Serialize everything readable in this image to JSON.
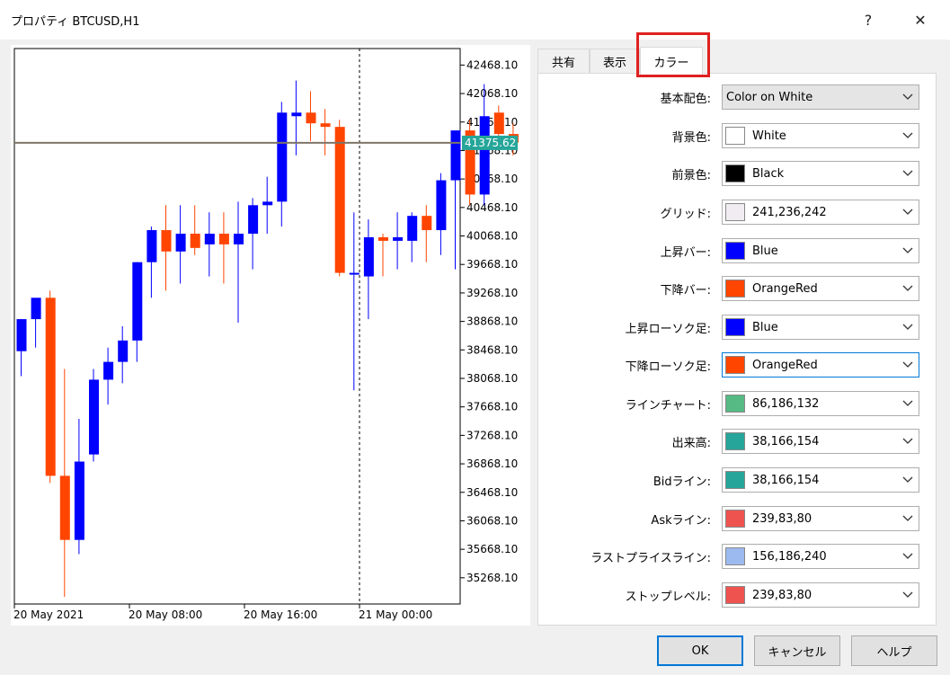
{
  "window": {
    "title": "プロパティ BTCUSD,H1",
    "help_glyph": "?",
    "close_glyph": "✕"
  },
  "tabs": [
    {
      "label": "共有",
      "active": false
    },
    {
      "label": "表示",
      "active": false
    },
    {
      "label": "カラー",
      "active": true
    }
  ],
  "color_rows": [
    {
      "label": "基本配色:",
      "value": "Color on White",
      "swatch": null
    },
    {
      "label": "背景色:",
      "value": "White",
      "swatch": "#ffffff"
    },
    {
      "label": "前景色:",
      "value": "Black",
      "swatch": "#000000"
    },
    {
      "label": "グリッド:",
      "value": "241,236,242",
      "swatch": "#f1ecf2"
    },
    {
      "label": "上昇バー:",
      "value": "Blue",
      "swatch": "#0000ff"
    },
    {
      "label": "下降バー:",
      "value": "OrangeRed",
      "swatch": "#ff4500"
    },
    {
      "label": "上昇ローソク足:",
      "value": "Blue",
      "swatch": "#0000ff"
    },
    {
      "label": "下降ローソク足:",
      "value": "OrangeRed",
      "swatch": "#ff4500"
    },
    {
      "label": "ラインチャート:",
      "value": "86,186,132",
      "swatch": "#56ba84"
    },
    {
      "label": "出来高:",
      "value": "38,166,154",
      "swatch": "#26a69a"
    },
    {
      "label": "Bidライン:",
      "value": "38,166,154",
      "swatch": "#26a69a"
    },
    {
      "label": "Askライン:",
      "value": "239,83,80",
      "swatch": "#ef5350"
    },
    {
      "label": "ラストプライスライン:",
      "value": "156,186,240",
      "swatch": "#9cbaf0"
    },
    {
      "label": "ストップレベル:",
      "value": "239,83,80",
      "swatch": "#ef5350"
    }
  ],
  "buttons": {
    "ok": "OK",
    "cancel": "キャンセル",
    "help": "ヘルプ"
  },
  "chart_data": {
    "type": "candlestick",
    "symbol": "BTCUSD,H1",
    "y_ticks": [
      "42468.10",
      "42068.10",
      "41668.10",
      "41268.10",
      "40868.10",
      "40468.10",
      "40068.10",
      "39668.10",
      "39268.10",
      "38868.10",
      "38468.10",
      "38068.10",
      "37668.10",
      "37268.10",
      "36868.10",
      "36468.10",
      "36068.10",
      "35668.10",
      "35268.10"
    ],
    "ylim": [
      34900,
      42700
    ],
    "x_ticks": [
      "20 May 2021",
      "20 May 08:00",
      "20 May 16:00",
      "21 May 00:00"
    ],
    "current_price_label": "41375.62",
    "current_price": 41375.62,
    "colors": {
      "up": "#0000ff",
      "down": "#ff4500",
      "price_tag": "#26a69a",
      "price_line": "#7f7467"
    },
    "candles": [
      {
        "o": 38450,
        "h": 38900,
        "l": 38100,
        "c": 38900
      },
      {
        "o": 38900,
        "h": 39000,
        "l": 38500,
        "c": 39200
      },
      {
        "o": 39200,
        "h": 39300,
        "l": 36600,
        "c": 36700
      },
      {
        "o": 36700,
        "h": 38200,
        "l": 35000,
        "c": 35800
      },
      {
        "o": 35800,
        "h": 37500,
        "l": 35600,
        "c": 36900
      },
      {
        "o": 37000,
        "h": 38200,
        "l": 36900,
        "c": 38050
      },
      {
        "o": 38050,
        "h": 38500,
        "l": 37700,
        "c": 38300
      },
      {
        "o": 38300,
        "h": 38800,
        "l": 38000,
        "c": 38600
      },
      {
        "o": 38600,
        "h": 39700,
        "l": 38300,
        "c": 39700
      },
      {
        "o": 39700,
        "h": 40200,
        "l": 39200,
        "c": 40150
      },
      {
        "o": 40150,
        "h": 40500,
        "l": 39300,
        "c": 39850
      },
      {
        "o": 39850,
        "h": 40500,
        "l": 39400,
        "c": 40100
      },
      {
        "o": 40100,
        "h": 40500,
        "l": 39800,
        "c": 39900
      },
      {
        "o": 39950,
        "h": 40400,
        "l": 39500,
        "c": 40100
      },
      {
        "o": 40100,
        "h": 40400,
        "l": 39400,
        "c": 39950
      },
      {
        "o": 39950,
        "h": 40550,
        "l": 38850,
        "c": 40100
      },
      {
        "o": 40100,
        "h": 40600,
        "l": 39600,
        "c": 40500
      },
      {
        "o": 40500,
        "h": 40900,
        "l": 40100,
        "c": 40550
      },
      {
        "o": 40550,
        "h": 41950,
        "l": 40200,
        "c": 41800
      },
      {
        "o": 41750,
        "h": 42250,
        "l": 41200,
        "c": 41800
      },
      {
        "o": 41800,
        "h": 42100,
        "l": 41400,
        "c": 41650
      },
      {
        "o": 41650,
        "h": 41850,
        "l": 41200,
        "c": 41600
      },
      {
        "o": 41600,
        "h": 41700,
        "l": 39500,
        "c": 39550
      },
      {
        "o": 39550,
        "h": 40400,
        "l": 37900,
        "c": 39550
      },
      {
        "o": 39500,
        "h": 40300,
        "l": 38900,
        "c": 40050
      },
      {
        "o": 40050,
        "h": 40100,
        "l": 39500,
        "c": 40000
      },
      {
        "o": 40000,
        "h": 40400,
        "l": 39600,
        "c": 40050
      },
      {
        "o": 40000,
        "h": 40400,
        "l": 39700,
        "c": 40350
      },
      {
        "o": 40350,
        "h": 40500,
        "l": 39700,
        "c": 40150
      },
      {
        "o": 40150,
        "h": 40950,
        "l": 39800,
        "c": 40850
      },
      {
        "o": 40850,
        "h": 41500,
        "l": 39600,
        "c": 41550
      },
      {
        "o": 41550,
        "h": 41700,
        "l": 40500,
        "c": 40650
      },
      {
        "o": 40650,
        "h": 42200,
        "l": 40500,
        "c": 41750
      },
      {
        "o": 41800,
        "h": 41900,
        "l": 41300,
        "c": 41500
      },
      {
        "o": 41500,
        "h": 41650,
        "l": 41200,
        "c": 41380
      }
    ],
    "grid": false,
    "crosshair_at_label": "21 May 00:00"
  }
}
